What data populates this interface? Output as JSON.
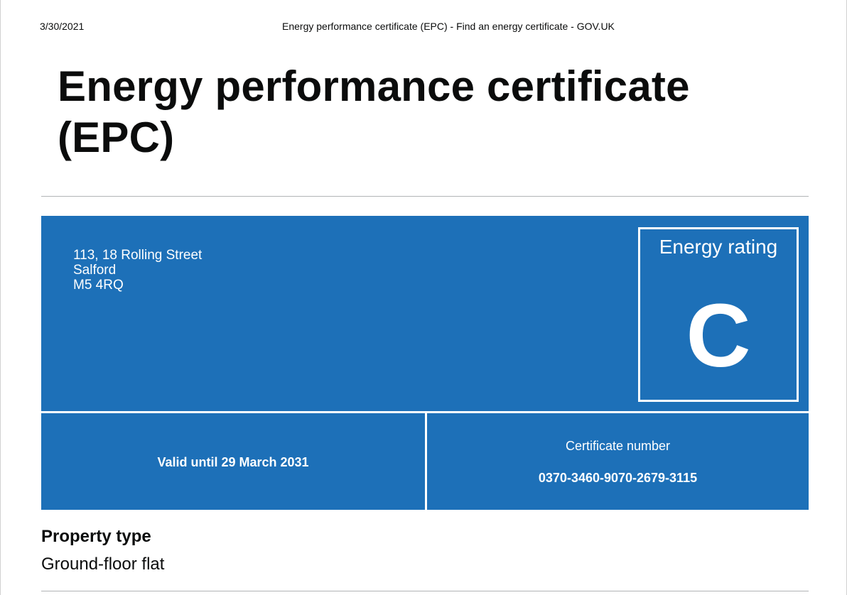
{
  "print_header": {
    "date": "3/30/2021",
    "title": "Energy performance certificate (EPC) - Find an energy certificate - GOV.UK"
  },
  "page": {
    "heading": "Energy performance certificate (EPC)"
  },
  "certificate": {
    "address": {
      "line1": "113, 18 Rolling Street",
      "line2": "Salford",
      "postcode": "M5 4RQ"
    },
    "rating_label": "Energy rating",
    "rating": "C",
    "valid_until": "Valid until 29 March 2031",
    "number_label": "Certificate number",
    "number": "0370-3460-9070-2679-3115",
    "panel_color": "#1d70b8"
  },
  "property": {
    "heading": "Property type",
    "value": "Ground-floor flat"
  }
}
